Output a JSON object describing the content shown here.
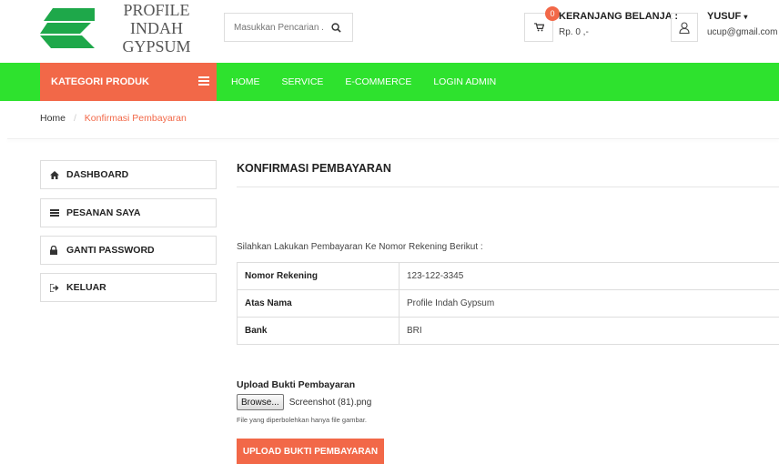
{
  "brand": {
    "line1": "PROFILE INDAH",
    "line2": "GYPSUM",
    "colors": {
      "green": "#2ee22e",
      "accent": "#f26848",
      "logo_green": "#1ea84a"
    }
  },
  "search": {
    "placeholder": "Masukkan Pencarian ..",
    "icon": "search-icon"
  },
  "cart": {
    "count": "0",
    "title": "KERANJANG BELANJA :",
    "total": "Rp. 0 ,-",
    "icon": "cart-icon"
  },
  "user": {
    "name": "YUSUF",
    "email": "ucup@gmail.com",
    "icon": "user-icon"
  },
  "nav": {
    "kategori": "KATEGORI PRODUK",
    "links": [
      "HOME",
      "SERVICE",
      "E-COMMERCE",
      "LOGIN ADMIN"
    ]
  },
  "breadcrumb": {
    "home": "Home",
    "separator": "/",
    "current": "Konfirmasi Pembayaran"
  },
  "sidebar": {
    "items": [
      {
        "label": "DASHBOARD",
        "icon": "home-icon"
      },
      {
        "label": "PESANAN SAYA",
        "icon": "list-icon"
      },
      {
        "label": "GANTI PASSWORD",
        "icon": "lock-icon"
      },
      {
        "label": "KELUAR",
        "icon": "sign-out-icon"
      }
    ]
  },
  "main": {
    "title": "KONFIRMASI PEMBAYARAN",
    "instruction": "Silahkan Lakukan Pembayaran Ke Nomor Rekening Berikut :",
    "table": [
      {
        "key": "Nomor Rekening",
        "value": "123-122-3345"
      },
      {
        "key": "Atas Nama",
        "value": "Profile Indah Gypsum"
      },
      {
        "key": "Bank",
        "value": "BRI"
      }
    ],
    "upload": {
      "label": "Upload Bukti Pembayaran",
      "browse": "Browse...",
      "file_name": "Screenshot (81).png",
      "hint": "File yang diperbolehkan hanya file gambar.",
      "button": "UPLOAD BUKTI PEMBAYARAN"
    }
  }
}
